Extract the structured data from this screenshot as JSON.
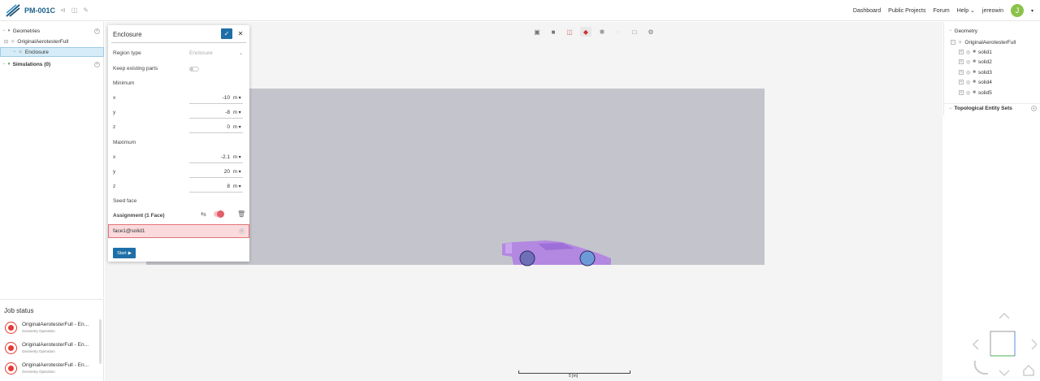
{
  "header": {
    "project_name": "PM-001C",
    "nav": [
      "Dashboard",
      "Public Projects",
      "Forum",
      "Help ⌄"
    ],
    "username": "jereowin",
    "avatar_initial": "J",
    "avatar_color": "#8bc34a",
    "brand_color": "#1b5f8a"
  },
  "tree": {
    "geometries_label": "Geometries",
    "geometry_item": "OriginalAerotesterFull",
    "enclosure_item": "Enclosure",
    "simulations_label": "Simulations (0)"
  },
  "dialog": {
    "title": "Enclosure",
    "region_type_label": "Region type",
    "region_type_value": "Enclosure",
    "keep_parts_label": "Keep existing parts",
    "minimum_label": "Minimum",
    "min": {
      "x_label": "x",
      "x_value": "-10",
      "x_unit": "m ▾",
      "y_label": "y",
      "y_value": "-8",
      "y_unit": "m ▾",
      "z_label": "z",
      "z_value": "0",
      "z_unit": "m ▾"
    },
    "maximum_label": "Maximum",
    "max": {
      "x_label": "x",
      "x_value": "-2.1",
      "x_unit": "m ▾",
      "y_label": "y",
      "y_value": "20",
      "y_unit": "m ▾",
      "z_label": "z",
      "z_value": "8",
      "z_unit": "m ▾"
    },
    "seed_face_label": "Seed face",
    "assignment_label": "Assignment (1 Face)",
    "face_value": "face1@solid1",
    "start_label": "Start"
  },
  "right_panel": {
    "geometry_label": "Geometry",
    "root_item": "OriginalAerotesterFull",
    "solids": [
      "solid1",
      "solid2",
      "solid3",
      "solid4",
      "solid5"
    ],
    "topo_label": "Topological Entity Sets"
  },
  "job_status": {
    "title": "Job status",
    "jobs": [
      {
        "name": "OriginalAerotesterFull - En...",
        "sub": "Geometry Operation"
      },
      {
        "name": "OriginalAerotesterFull - En...",
        "sub": "Geometry Operation"
      },
      {
        "name": "OriginalAerotesterFull - En...",
        "sub": "Geometry Operation"
      }
    ]
  },
  "viewport": {
    "scale_label": "5 [m]",
    "domain_color": "#c4c4cc",
    "car_color": "#b388e0"
  }
}
